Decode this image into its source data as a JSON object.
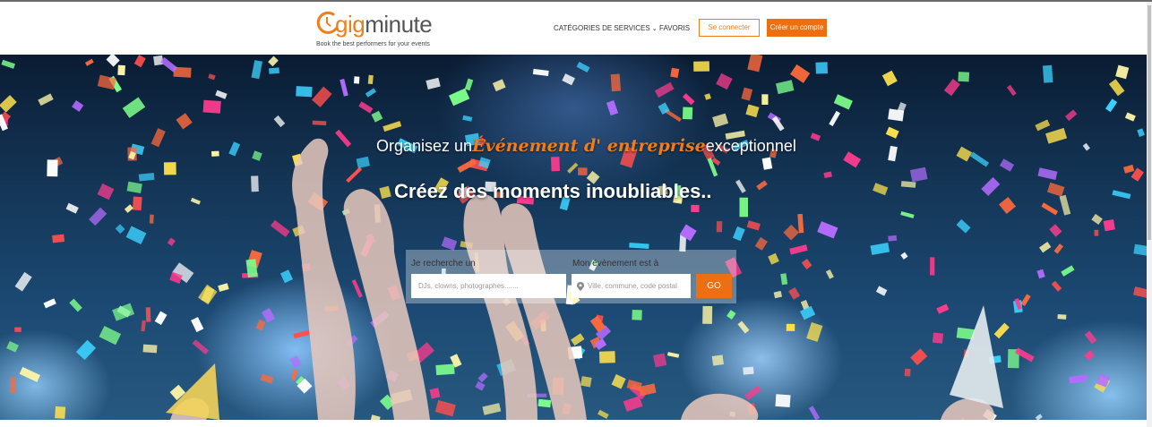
{
  "header": {
    "logo": {
      "gig": "gig",
      "minute": "minute",
      "tagline": "Book the best performers for your events",
      "accent_color": "#f07c1a"
    },
    "nav": {
      "categories_label": "CATÉGORIES DE SERVICES",
      "favorites_label": "FAVORIS"
    },
    "login_label": "Se connecter",
    "signup_label": "Créer un compte"
  },
  "hero": {
    "subtitle_prefix": "Organisez un",
    "subtitle_highlight": "Événement d' entreprise",
    "subtitle_suffix": "exceptionnel",
    "title": "Créez des moments inoubliables..",
    "search": {
      "what_label": "Je recherche un",
      "what_placeholder": "DJs, clowns, photographes.......",
      "where_label": "Mon évènement est à",
      "where_placeholder": "Ville, commune, code postal",
      "go_label": "GO"
    }
  },
  "icons": {
    "location": "map-pin-icon",
    "dropdown": "chevron-down-icon"
  },
  "colors": {
    "brand_orange": "#ee6f0f",
    "text_dark": "#333333"
  }
}
